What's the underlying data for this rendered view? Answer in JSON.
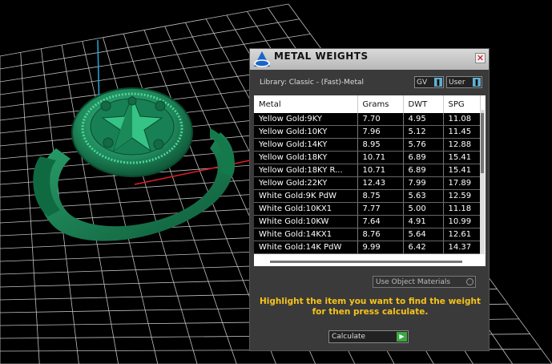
{
  "window": {
    "title": "METAL WEIGHTS",
    "close_glyph": "✕"
  },
  "library": {
    "label": "Library: Classic - (Fast)-Metal",
    "gv_label": "GV",
    "user_label": "User"
  },
  "table": {
    "headers": [
      "Metal",
      "Grams",
      "DWT",
      "SPG"
    ],
    "rows": [
      [
        "Yellow Gold:9KY",
        "7.70",
        "4.95",
        "11.08"
      ],
      [
        "Yellow Gold:10KY",
        "7.96",
        "5.12",
        "11.45"
      ],
      [
        "Yellow Gold:14KY",
        "8.95",
        "5.76",
        "12.88"
      ],
      [
        "Yellow Gold:18KY",
        "10.71",
        "6.89",
        "15.41"
      ],
      [
        "Yellow Gold:18KY R...",
        "10.71",
        "6.89",
        "15.41"
      ],
      [
        "Yellow Gold:22KY",
        "12.43",
        "7.99",
        "17.89"
      ],
      [
        "White Gold:9K PdW",
        "8.75",
        "5.63",
        "12.59"
      ],
      [
        "White Gold:10KX1",
        "7.77",
        "5.00",
        "11.18"
      ],
      [
        "White Gold:10KW",
        "7.64",
        "4.91",
        "10.99"
      ],
      [
        "White Gold:14KX1",
        "8.76",
        "5.64",
        "12.61"
      ],
      [
        "White Gold:14K PdW",
        "9.99",
        "6.42",
        "14.37"
      ]
    ]
  },
  "use_object_materials": "Use Object Materials",
  "hint": "Highlight the item you want to find the weight for then press calculate.",
  "calculate_label": "Calculate",
  "colors": {
    "ring": "#1f8a5c",
    "grid": "#bfbfbf",
    "hint": "#f7c31a"
  }
}
